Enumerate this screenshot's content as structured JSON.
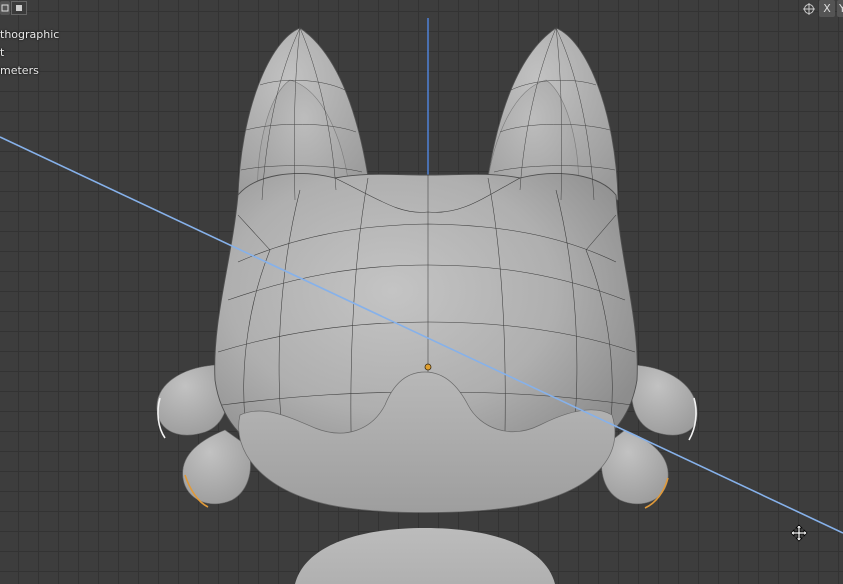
{
  "overlay": {
    "view_mode": "thographic",
    "collection": "t",
    "units": "meters"
  },
  "header": {
    "x_label": "X",
    "y_label": "Y"
  },
  "colors": {
    "viewport_bg": "#3d3d3d",
    "grid_line": "#333333",
    "z_axis": "#4f82d6",
    "x_axis_line": "#86b1ea",
    "mesh_surface": "#b4b4b4",
    "origin_point": "#e0a030"
  },
  "icons": [
    "view-modes-icon",
    "gizmo-toggle-icon",
    "navigate-gizmo-icon",
    "origin-icon"
  ]
}
